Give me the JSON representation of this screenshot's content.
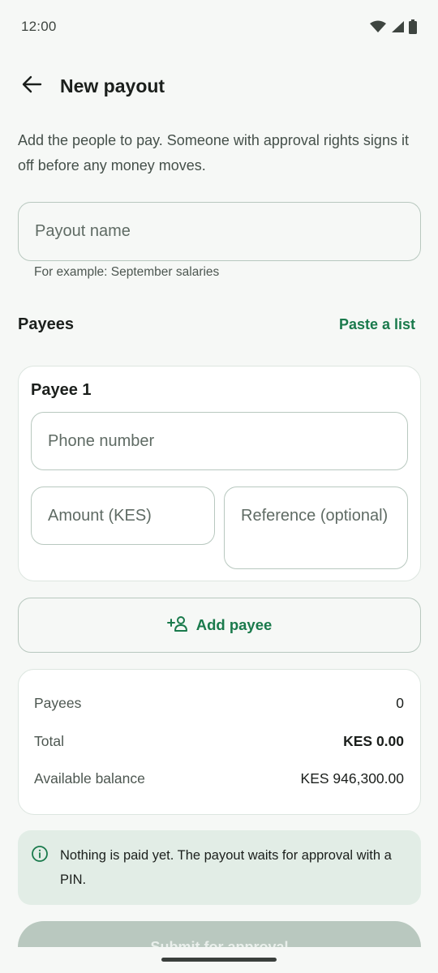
{
  "status_bar": {
    "time": "12:00",
    "icons": [
      "wifi-icon",
      "signal-icon",
      "battery-icon"
    ]
  },
  "app_bar": {
    "back_icon": "arrow-left-icon",
    "title": "New payout"
  },
  "intro_text": "Add the people to pay. Someone with approval rights signs it off before any money moves.",
  "payout_name": {
    "placeholder": "Payout name",
    "value": "",
    "helper": "For example: September salaries"
  },
  "payees_section": {
    "title": "Payees",
    "paste_label": "Paste a list"
  },
  "payee_card": {
    "title": "Payee 1",
    "phone_placeholder": "Phone number",
    "amount_placeholder": "Amount (KES)",
    "reference_placeholder": "Reference (optional)"
  },
  "add_payee": {
    "icon": "person-add-icon",
    "label": "Add payee"
  },
  "summary": {
    "rows": [
      {
        "label": "Payees",
        "value": "0"
      },
      {
        "label": "Total",
        "value": "KES 0.00"
      },
      {
        "label": "Available balance",
        "value": "KES 946,300.00"
      }
    ]
  },
  "notice": {
    "icon": "info-icon",
    "text": "Nothing is paid yet. The payout waits for approval with a PIN."
  },
  "submit": {
    "label": "Submit for approval"
  },
  "colors": {
    "accent": "#1a7a4c",
    "background": "#f6f8f6",
    "notice_bg": "#e2ede6",
    "disabled_button": "#b9c8bf"
  }
}
